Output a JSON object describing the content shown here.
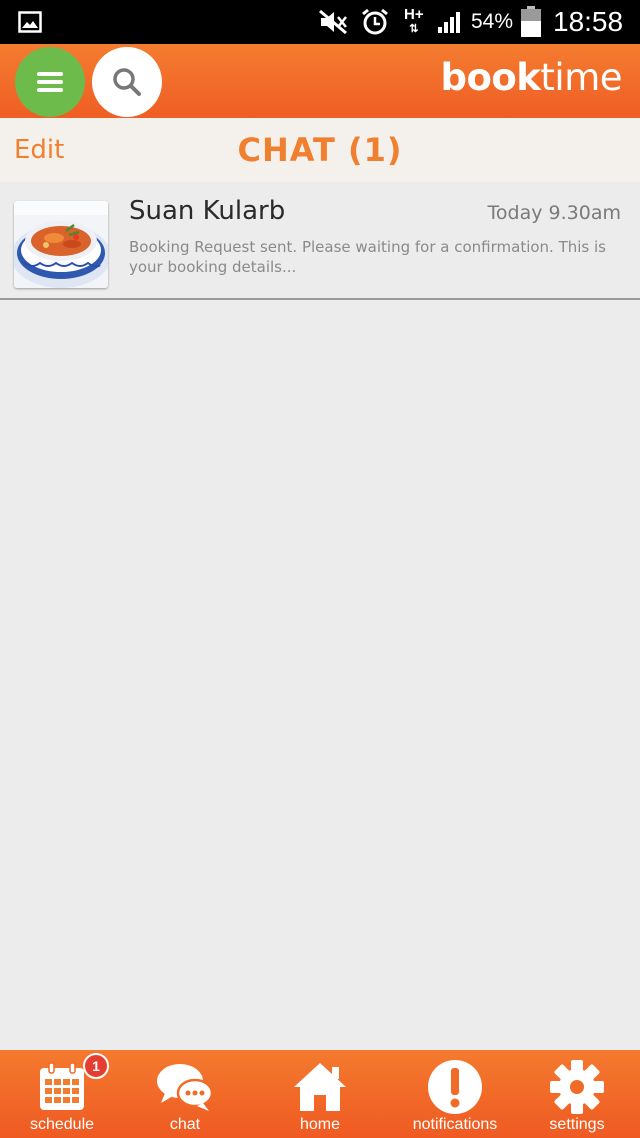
{
  "status_bar": {
    "battery_percent": "54%",
    "time": "18:58",
    "network_type": "H+",
    "icons": [
      "gallery-icon",
      "mute-icon",
      "alarm-icon",
      "signal-icon",
      "battery-icon"
    ]
  },
  "header": {
    "brand_bold": "book",
    "brand_regular": "time",
    "menu_icon": "hamburger-icon",
    "search_icon": "search-icon"
  },
  "title_bar": {
    "edit_label": "Edit",
    "title": "CHAT (1)"
  },
  "chats": [
    {
      "name": "Suan Kularb",
      "time": "Today 9.30am",
      "preview": "Booking Request sent. Please waiting for a confirmation. This is your booking details..."
    }
  ],
  "bottom_nav": {
    "items": [
      {
        "label": "schedule",
        "icon": "calendar-icon",
        "badge": "1"
      },
      {
        "label": "chat",
        "icon": "chat-bubbles-icon"
      },
      {
        "label": "home",
        "icon": "home-icon"
      },
      {
        "label": "notifications",
        "icon": "exclamation-icon"
      },
      {
        "label": "settings",
        "icon": "gear-icon"
      }
    ]
  },
  "colors": {
    "brand_orange": "#f07f2f",
    "menu_green": "#6dbb4b",
    "badge_red": "#e53d2f"
  }
}
